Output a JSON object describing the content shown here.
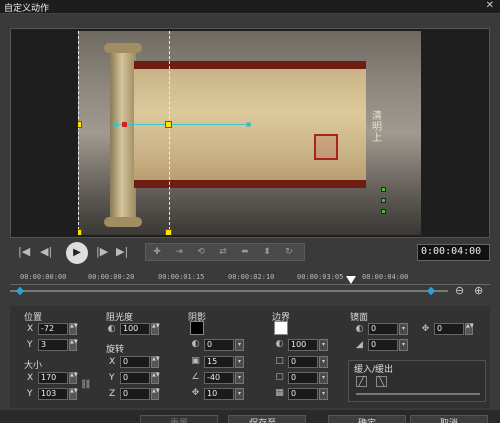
{
  "window": {
    "title": "自定义动作",
    "close_glyph": "✕"
  },
  "preview": {
    "side_text": "清 明 上"
  },
  "transport": {
    "buttons": [
      "|◀",
      "◀|",
      "▶",
      "|▶",
      "▶|"
    ],
    "ops": [
      "✚",
      "⇥",
      "⟲",
      "⇄",
      "⬌",
      "⬍",
      "↻"
    ],
    "timecode": "0:00:04:00"
  },
  "timeline": {
    "ticks": [
      "00:00:00:00",
      "00:00:00:20",
      "00:00:01:15",
      "00:00:02:10",
      "00:00:03:05",
      "00:00:04:00"
    ],
    "zoom_out": "⊖",
    "zoom_in": "⊕"
  },
  "position": {
    "title": "位置",
    "x_label": "X",
    "x_value": "-72",
    "y_label": "Y",
    "y_value": "3"
  },
  "size": {
    "title": "大小",
    "x_label": "X",
    "x_value": "170",
    "y_label": "Y",
    "y_value": "103"
  },
  "opacity": {
    "title": "阻光度",
    "value": "100"
  },
  "rotation": {
    "title": "旋转",
    "x_label": "X",
    "x_value": "0",
    "y_label": "Y",
    "y_value": "0",
    "z_label": "Z",
    "z_value": "0"
  },
  "shadow": {
    "title": "阴影",
    "color": "#000000",
    "opacity": "0",
    "size": "15",
    "angle": "-40",
    "distance": "10"
  },
  "border": {
    "title": "边界",
    "color": "#ffffff",
    "opacity": "100",
    "width": "0",
    "val2": "0",
    "val3": "0"
  },
  "mirror": {
    "title": "镜面",
    "opacity": "0",
    "offset": "0",
    "rot": "0"
  },
  "fade": {
    "title": "缓入/缓出"
  },
  "footer": {
    "reset": "重置",
    "save_to": "保存至...",
    "ok": "确定",
    "cancel": "取消"
  }
}
